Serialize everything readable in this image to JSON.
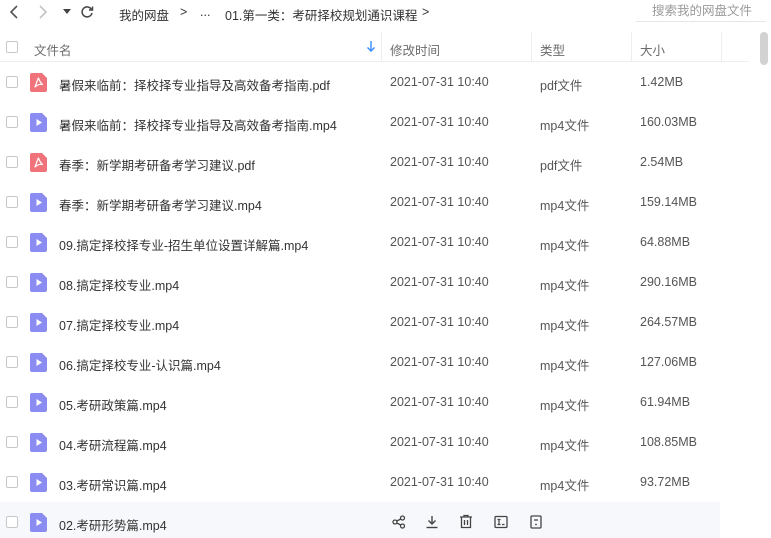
{
  "nav": {
    "breadcrumbs": [
      "我的网盘",
      "...",
      "01.第一类：考研择校规划通识课程"
    ],
    "separator": ">"
  },
  "search": {
    "placeholder": "搜索我的网盘文件"
  },
  "columns": {
    "name": "文件名",
    "modified": "修改时间",
    "type": "类型",
    "size": "大小"
  },
  "colors": {
    "pdf_icon": "#f0737b",
    "video_icon": "#8a8cf2",
    "hover_row": "#f7f8fb",
    "sort_arrow": "#3b8cff"
  },
  "files": [
    {
      "name": "暑假来临前：择校择专业指导及高效备考指南.pdf",
      "modified": "2021-07-31 10:40",
      "type": "pdf文件",
      "size": "1.42MB",
      "icon": "pdf-icon"
    },
    {
      "name": "暑假来临前：择校择专业指导及高效备考指南.mp4",
      "modified": "2021-07-31 10:40",
      "type": "mp4文件",
      "size": "160.03MB",
      "icon": "video-icon"
    },
    {
      "name": "春季：新学期考研备考学习建议.pdf",
      "modified": "2021-07-31 10:40",
      "type": "pdf文件",
      "size": "2.54MB",
      "icon": "pdf-icon"
    },
    {
      "name": "春季：新学期考研备考学习建议.mp4",
      "modified": "2021-07-31 10:40",
      "type": "mp4文件",
      "size": "159.14MB",
      "icon": "video-icon"
    },
    {
      "name": "09.搞定择校择专业-招生单位设置详解篇.mp4",
      "modified": "2021-07-31 10:40",
      "type": "mp4文件",
      "size": "64.88MB",
      "icon": "video-icon"
    },
    {
      "name": "08.搞定择校专业.mp4",
      "modified": "2021-07-31 10:40",
      "type": "mp4文件",
      "size": "290.16MB",
      "icon": "video-icon"
    },
    {
      "name": "07.搞定择校专业.mp4",
      "modified": "2021-07-31 10:40",
      "type": "mp4文件",
      "size": "264.57MB",
      "icon": "video-icon"
    },
    {
      "name": "06.搞定择校专业-认识篇.mp4",
      "modified": "2021-07-31 10:40",
      "type": "mp4文件",
      "size": "127.06MB",
      "icon": "video-icon"
    },
    {
      "name": "05.考研政策篇.mp4",
      "modified": "2021-07-31 10:40",
      "type": "mp4文件",
      "size": "61.94MB",
      "icon": "video-icon"
    },
    {
      "name": "04.考研流程篇.mp4",
      "modified": "2021-07-31 10:40",
      "type": "mp4文件",
      "size": "108.85MB",
      "icon": "video-icon"
    },
    {
      "name": "03.考研常识篇.mp4",
      "modified": "2021-07-31 10:40",
      "type": "mp4文件",
      "size": "93.72MB",
      "icon": "video-icon"
    },
    {
      "name": "02.考研形势篇.mp4",
      "modified": "",
      "type": "",
      "size": "",
      "icon": "video-icon",
      "hovered": true,
      "row_actions": [
        "share-icon",
        "download-icon",
        "delete-icon",
        "rename-icon",
        "more-icon"
      ]
    }
  ]
}
